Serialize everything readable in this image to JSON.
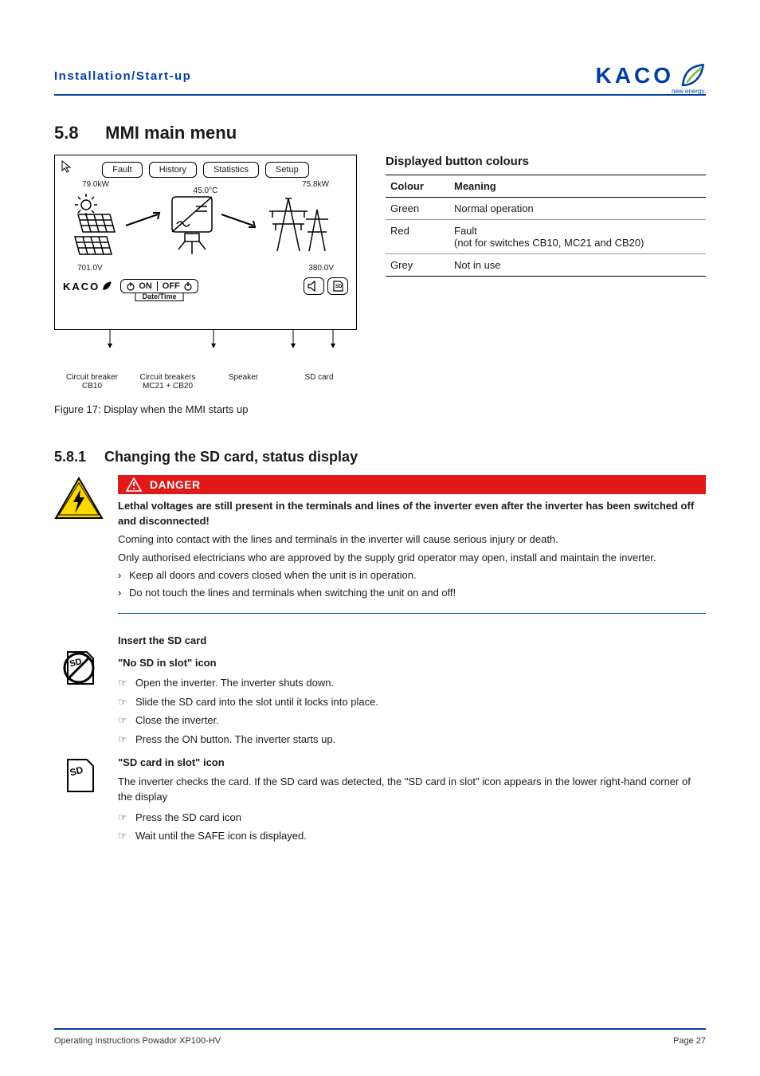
{
  "header": {
    "title": "Installation/Start-up"
  },
  "logo": {
    "text": "KACO",
    "sub": "new energy."
  },
  "section_5_8": {
    "num": "5.8",
    "title": "MMI main menu"
  },
  "mmi": {
    "tabs": [
      "Fault",
      "History",
      "Statistics",
      "Setup"
    ],
    "kw_left": "79.0kW",
    "kw_right": "75.8kW",
    "temp": "45.0°C",
    "v_left": "701.0V",
    "v_right": "380.0V",
    "on": "ON",
    "off": "OFF",
    "date_time": "Date/Time",
    "kaco_mini": "KACO",
    "callouts": {
      "left_line1": "Circuit breaker",
      "left_line2": "CB10",
      "mid_line1": "Circuit breakers",
      "mid_line2": "MC21 + CB20",
      "speaker": "Speaker",
      "sd": "SD card"
    },
    "figure": "Figure 17:  Display when the MMI starts up"
  },
  "colours": {
    "heading": "Displayed button colours",
    "th1": "Colour",
    "th2": "Meaning",
    "rows": [
      {
        "c": "Green",
        "m": "Normal operation"
      },
      {
        "c": "Red",
        "m": "Fault\n(not for switches CB10, MC21 and CB20)"
      },
      {
        "c": "Grey",
        "m": "Not in use"
      }
    ]
  },
  "section_5_8_1": {
    "num": "5.8.1",
    "title": "Changing the SD card, status display"
  },
  "danger": {
    "label": "DANGER",
    "lead": "Lethal voltages are still present in the terminals and lines of the inverter even after the inverter has been switched off and disconnected!",
    "p1": "Coming into contact with the lines and terminals in the inverter will cause serious injury or death.",
    "p2": "Only authorised electricians who are approved by the supply grid operator may open, install and maintain the inverter.",
    "b1": "Keep all doors and covers closed when the unit is in operation.",
    "b2": "Do not touch the lines and terminals when switching the unit on and off!"
  },
  "sd": {
    "insert_h": "Insert the SD card",
    "no_sd_h": "\"No SD in slot\" icon",
    "steps_a": [
      "Open the inverter. The inverter shuts down.",
      "Slide the SD card into the slot until it locks into place.",
      "Close the inverter.",
      "Press the ON button. The inverter starts up."
    ],
    "in_slot_h": "\"SD card in slot\" icon",
    "in_slot_p": "The inverter checks the card. If the SD card was detected, the \"SD card in slot\" icon appears in the lower right-hand corner of the display",
    "steps_b": [
      "Press the SD card icon",
      "Wait until the SAFE icon is displayed."
    ]
  },
  "footer": {
    "left": "Operating Instructions Powador XP100-HV",
    "right": "Page 27"
  }
}
